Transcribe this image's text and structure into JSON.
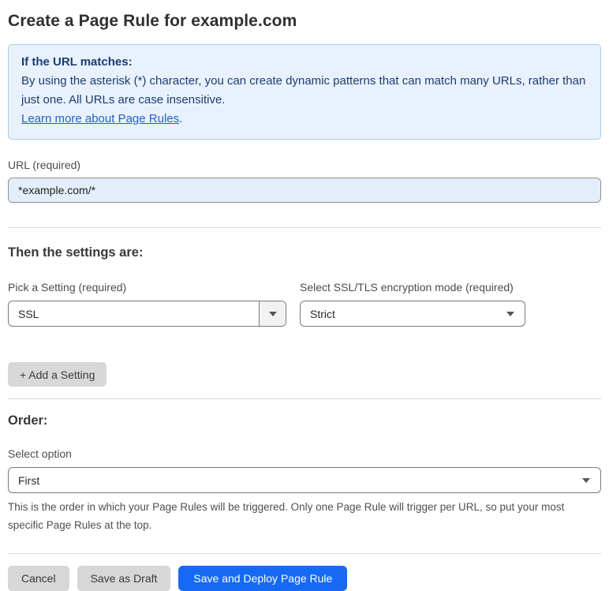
{
  "page": {
    "title": "Create a Page Rule for example.com"
  },
  "info_box": {
    "heading": "If the URL matches:",
    "body": "By using the asterisk (*) character, you can create dynamic patterns that can match many URLs, rather than just one. All URLs are case insensitive.",
    "link": "Learn more about Page Rules",
    "link_suffix": "."
  },
  "url_field": {
    "label": "URL (required)",
    "value": "*example.com/*"
  },
  "settings": {
    "heading": "Then the settings are:",
    "setting_picker": {
      "label": "Pick a Setting (required)",
      "value": "SSL"
    },
    "mode_picker": {
      "label": "Select SSL/TLS encryption mode (required)",
      "value": "Strict"
    },
    "add_button": "+ Add a Setting"
  },
  "order": {
    "heading": "Order:",
    "label": "Select option",
    "value": "First",
    "help": "This is the order in which your Page Rules will be triggered. Only one Page Rule will trigger per URL, so put your most specific Page Rules at the top."
  },
  "actions": {
    "cancel": "Cancel",
    "save_draft": "Save as Draft",
    "save_deploy": "Save and Deploy Page Rule"
  },
  "colors": {
    "accent_blue": "#1569F3",
    "info_bg": "#E9F2FC",
    "info_border": "#A9CBEA",
    "info_text": "#1B3C74",
    "link_blue": "#2061C9",
    "input_bg": "#E4EEFA"
  }
}
